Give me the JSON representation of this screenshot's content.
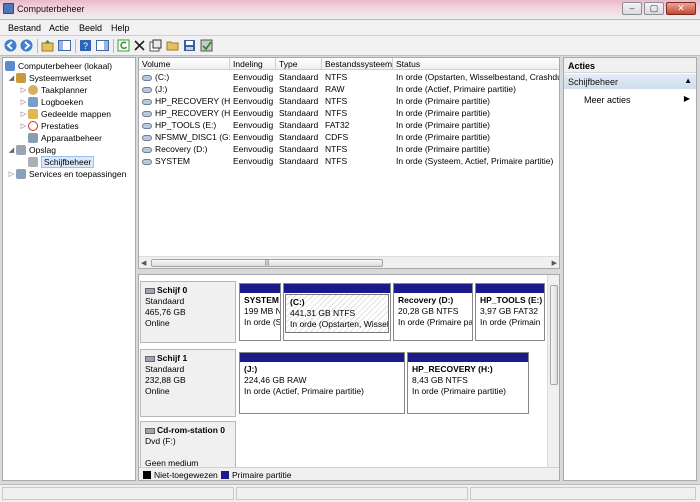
{
  "window": {
    "title": "Computerbeheer",
    "min_glyph": "–",
    "max_glyph": "▢",
    "close_glyph": "✕"
  },
  "menu": [
    "Bestand",
    "Actie",
    "Beeld",
    "Help"
  ],
  "tree": {
    "root": "Computerbeheer (lokaal)",
    "system_tools": "Systeemwerkset",
    "task_scheduler": "Taakplanner",
    "event_viewer": "Logboeken",
    "shared_folders": "Gedeelde mappen",
    "performance": "Prestaties",
    "device_manager": "Apparaatbeheer",
    "storage": "Opslag",
    "disk_management": "Schijfbeheer",
    "services": "Services en toepassingen"
  },
  "volume_columns": [
    "Volume",
    "Indeling",
    "Type",
    "Bestandssysteem",
    "Status"
  ],
  "volumes": [
    {
      "volume": "(C:)",
      "layout": "Eenvoudig",
      "type": "Standaard",
      "fs": "NTFS",
      "status": "In orde (Opstarten, Wisselbestand, Crashdu"
    },
    {
      "volume": "(J:)",
      "layout": "Eenvoudig",
      "type": "Standaard",
      "fs": "RAW",
      "status": "In orde (Actief, Primaire partitie)"
    },
    {
      "volume": "HP_RECOVERY (H:)",
      "layout": "Eenvoudig",
      "type": "Standaard",
      "fs": "NTFS",
      "status": "In orde (Primaire partitie)"
    },
    {
      "volume": "HP_RECOVERY (H:)",
      "layout": "Eenvoudig",
      "type": "Standaard",
      "fs": "NTFS",
      "status": "In orde (Primaire partitie)"
    },
    {
      "volume": "HP_TOOLS (E:)",
      "layout": "Eenvoudig",
      "type": "Standaard",
      "fs": "FAT32",
      "status": "In orde (Primaire partitie)"
    },
    {
      "volume": "NFSMW_DISC1 (G:)",
      "layout": "Eenvoudig",
      "type": "Standaard",
      "fs": "CDFS",
      "status": "In orde (Primaire partitie)"
    },
    {
      "volume": "Recovery (D:)",
      "layout": "Eenvoudig",
      "type": "Standaard",
      "fs": "NTFS",
      "status": "In orde (Primaire partitie)"
    },
    {
      "volume": "SYSTEM",
      "layout": "Eenvoudig",
      "type": "Standaard",
      "fs": "NTFS",
      "status": "In orde (Systeem, Actief, Primaire partitie)"
    }
  ],
  "disks": [
    {
      "name": "Schijf 0",
      "kind": "Standaard",
      "size": "465,76 GB",
      "state": "Online",
      "partitions": [
        {
          "name": "SYSTEM",
          "size": "199 MB N",
          "status": "In orde (S"
        },
        {
          "name": "(C:)",
          "size": "441,31 GB NTFS",
          "status": "In orde (Opstarten, Wissel"
        },
        {
          "name": "Recovery  (D:)",
          "size": "20,28 GB NTFS",
          "status": "In orde (Primaire pa"
        },
        {
          "name": "HP_TOOLS  (E:)",
          "size": "3,97 GB FAT32",
          "status": "In orde (Primain"
        }
      ]
    },
    {
      "name": "Schijf 1",
      "kind": "Standaard",
      "size": "232,88 GB",
      "state": "Online",
      "partitions": [
        {
          "name": "(J:)",
          "size": "224,46 GB RAW",
          "status": "In orde (Actief, Primaire partitie)"
        },
        {
          "name": "HP_RECOVERY  (H:)",
          "size": "8,43 GB NTFS",
          "status": "In orde (Primaire partitie)"
        }
      ]
    },
    {
      "name": "Cd-rom-station 0",
      "kind": "Dvd (F:)",
      "size": "",
      "state": "Geen medium",
      "partitions": []
    }
  ],
  "legend": [
    "Niet-toegewezen",
    "Primaire partitie"
  ],
  "actions": {
    "header": "Acties",
    "section": "Schijfbeheer",
    "more": "Meer acties"
  },
  "colors": {
    "primary_partition": "#1a1a8a",
    "unallocated": "#000000",
    "selection": "#d9e8fb"
  }
}
